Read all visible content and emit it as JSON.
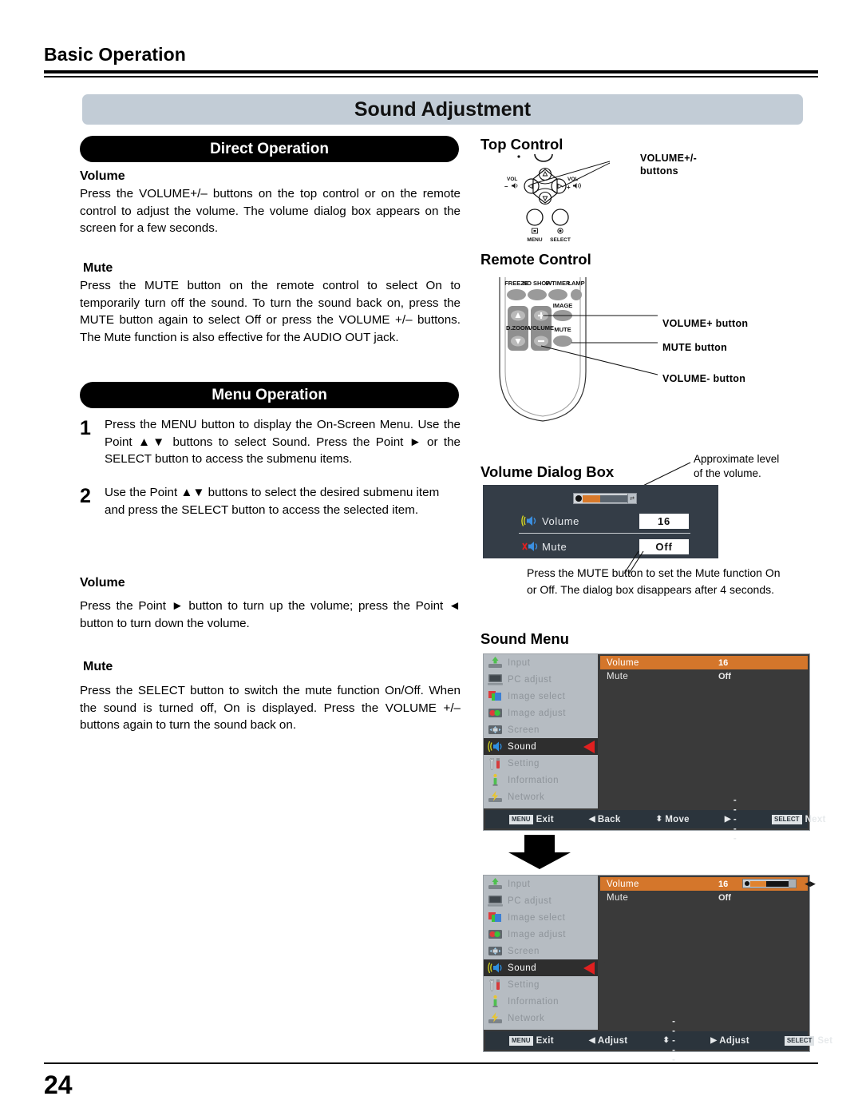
{
  "running_head": "Basic Operation",
  "section_title": "Sound Adjustment",
  "page_number": "24",
  "left": {
    "direct_operation_pill": "Direct Operation",
    "menu_operation_pill": "Menu Operation",
    "volume_heading_1": "Volume",
    "volume_body_1": "Press the VOLUME+/– buttons on the top control or on the remote control to adjust the volume. The volume dialog box appears on the screen for a few seconds.",
    "mute_heading_1": "Mute",
    "mute_body_1": "Press the MUTE button on the remote control to select On to temporarily turn off the sound. To turn the sound back on, press the MUTE button again to select Off or press the VOLUME +/– buttons. The Mute function is also effective for the AUDIO OUT jack.",
    "step1_num": "1",
    "step1_text": "Press the MENU button to display the On-Screen Menu. Use the Point ▲▼ buttons to select Sound. Press the Point ► or the SELECT button to access the submenu items.",
    "step2_num": "2",
    "step2_text": "Use the Point ▲▼ buttons to select the desired submenu item and press the SELECT button to access the selected item.",
    "volume_heading_2": "Volume",
    "volume_body_2": "Press the Point ► button to turn up the volume; press the Point ◄ button to turn down the volume.",
    "mute_heading_2": "Mute",
    "mute_body_2": "Press the SELECT button to switch the mute function On/Off. When the sound is turned off, On is displayed. Press the VOLUME +/– buttons again to turn the sound back on."
  },
  "right": {
    "top_control_heading": "Top Control",
    "top_control_callout": "VOLUME+/-\nbuttons",
    "top_control_labels": {
      "vol_minus_line1": "VOL",
      "vol_minus_line2": "–",
      "vol_plus_line1": "VOL",
      "vol_plus_line2": "+",
      "menu": "MENU",
      "select": "SELECT"
    },
    "remote_heading": "Remote Control",
    "remote_buttons": {
      "freeze": "FREEZE",
      "no_show": "NO SHOW",
      "p_timer": "P-TIMER",
      "lamp": "LAMP",
      "image": "IMAGE",
      "d_zoom": "D.ZOOM",
      "volume": "VOLUME",
      "mute": "MUTE"
    },
    "remote_callouts": {
      "volume_plus": "VOLUME+ button",
      "mute": "MUTE button",
      "volume_minus": "VOLUME- button"
    },
    "volume_dialog_heading": "Volume Dialog Box",
    "volume_dialog_callout": "Approximate level\nof the volume.",
    "volume_dialog": {
      "volume_label": "Volume",
      "volume_value": "16",
      "mute_label": "Mute",
      "mute_value": "Off"
    },
    "volume_dialog_note": "Press the MUTE button to set the Mute function On or Off. The dialog box disappears after 4 seconds.",
    "sound_menu_heading": "Sound Menu"
  },
  "osd": {
    "sidebar_items": [
      {
        "label": "Input",
        "icon": "input-icon"
      },
      {
        "label": "PC adjust",
        "icon": "monitor-icon"
      },
      {
        "label": "Image select",
        "icon": "image-select-icon"
      },
      {
        "label": "Image adjust",
        "icon": "image-adjust-icon"
      },
      {
        "label": "Screen",
        "icon": "screen-icon"
      },
      {
        "label": "Sound",
        "icon": "speaker-icon"
      },
      {
        "label": "Setting",
        "icon": "tools-icon"
      },
      {
        "label": "Information",
        "icon": "info-icon"
      },
      {
        "label": "Network",
        "icon": "network-icon"
      }
    ],
    "selected_index": 5,
    "menu1": {
      "rows": [
        {
          "key": "Volume",
          "value": "16",
          "highlighted": true
        },
        {
          "key": "Mute",
          "value": "Off",
          "highlighted": false
        }
      ],
      "bottom": [
        {
          "key": "MENU",
          "label": "Exit",
          "glyph": ""
        },
        {
          "key": "",
          "label": "Back",
          "glyph": "◀"
        },
        {
          "key": "",
          "label": "Move",
          "glyph": "⬍"
        },
        {
          "key": "",
          "label": "-----",
          "glyph": "▶"
        },
        {
          "key": "SELECT",
          "label": "Next",
          "glyph": ""
        }
      ]
    },
    "menu2": {
      "rows": [
        {
          "key": "Volume",
          "value": "16",
          "highlighted": true,
          "slider": true
        },
        {
          "key": "Mute",
          "value": "Off",
          "highlighted": false,
          "slider": false
        }
      ],
      "bottom": [
        {
          "key": "MENU",
          "label": "Exit",
          "glyph": ""
        },
        {
          "key": "",
          "label": "Adjust",
          "glyph": "◀"
        },
        {
          "key": "",
          "label": "-----",
          "glyph": "⬍"
        },
        {
          "key": "",
          "label": "Adjust",
          "glyph": "▶"
        },
        {
          "key": "SELECT",
          "label": "Set",
          "glyph": ""
        }
      ]
    }
  },
  "colors": {
    "title_bar": "#c2ccd6",
    "osd_highlight": "#d4762b",
    "osd_sidebar": "#b6bcc2",
    "osd_panel": "#3a3a3a",
    "dialog_bg": "#343d47",
    "accent_red": "#e02020"
  }
}
